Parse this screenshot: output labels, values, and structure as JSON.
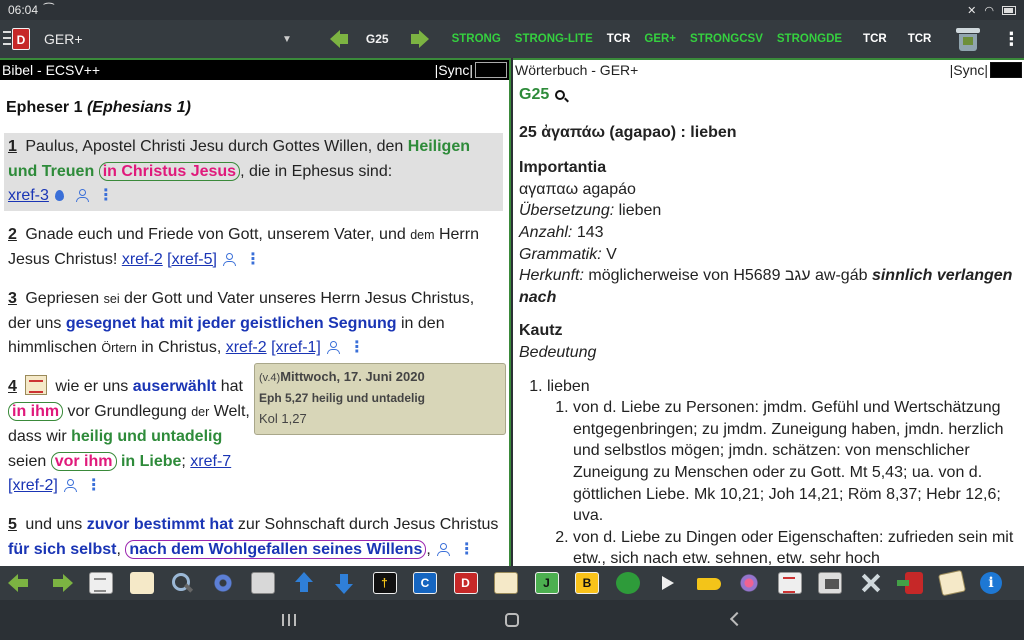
{
  "status": {
    "time": "06:04"
  },
  "toolbar": {
    "module": "GER+",
    "strong_number": "G25",
    "buttons": [
      {
        "label": "STRONG",
        "color": "green"
      },
      {
        "label": "STRONG-LITE",
        "color": "green"
      },
      {
        "label": "TCR",
        "color": "white"
      },
      {
        "label": "GER+",
        "color": "green"
      },
      {
        "label": "STRONGCSV",
        "color": "green"
      },
      {
        "label": "STRONGDE",
        "color": "green"
      },
      {
        "label": "TCR",
        "color": "white"
      },
      {
        "label": "TCR",
        "color": "white"
      }
    ]
  },
  "left_pane": {
    "title": "Bibel - ECSV++",
    "sync": "|Sync|",
    "heading": "Epheser 1",
    "heading_en": "(Ephesians 1)",
    "v1": {
      "num": "1",
      "t1": " Paulus, Apostel Christi Jesu durch Gottes Willen, den ",
      "g1": "Heiligen und Treuen",
      "box1": "in Christus Jesus",
      "t2": ", die in Ephesus sind:",
      "xref1": "xref-3"
    },
    "v2": {
      "num": "2",
      "t1": " Gnade euch und Friede von Gott, unserem Vater, und ",
      "s1": "dem",
      "t2": " Herrn Jesus Christus! ",
      "xref1": "xref-2",
      "xref2": "[xref-5]"
    },
    "v3": {
      "num": "3",
      "t1": " Gepriesen ",
      "s1": "sei",
      "t2": " der Gott und Vater unseres Herrn Jesus Christus, der uns ",
      "b1": "gesegnet hat mit jeder geistlichen Segnung",
      "t3": " in den himmlischen ",
      "s2": "Örtern",
      "t4": " in Christus, ",
      "xref1": "xref-2",
      "xref2": "[xref-1]"
    },
    "v4": {
      "num": "4",
      "t1": " wie er uns ",
      "b1": "auserwählt",
      "t2": " hat ",
      "box1": "in ihm",
      "t3": " vor Grundlegung ",
      "s1": "der",
      "t4": " Welt, dass wir ",
      "g1": "heilig und untadelig",
      "t5": " seien ",
      "box2": "vor ihm",
      "g2": " in Liebe",
      "t6": "; ",
      "xref1": "xref-7",
      "xref2": "[xref-2]"
    },
    "v5": {
      "num": "5",
      "t1": " und uns ",
      "b1": "zuvor bestimmt hat",
      "t2": " zur Sohnschaft durch Jesus Christus ",
      "b2": "für sich selbst",
      "t3": ", ",
      "box1": "nach dem Wohlgefallen seines Willens",
      "t4": ","
    },
    "note": {
      "ref": "(v.4)",
      "date": "Mittwoch, 17. Juni 2020",
      "line2": "Eph 5,27 heilig und untadelig",
      "line3": "Kol 1,27"
    }
  },
  "right_pane": {
    "title": "Wörterbuch - GER+",
    "sync": "|Sync|",
    "key": "G25",
    "entry": "25 ἀγαπάω (agapao) : lieben",
    "importantia": "Importantia",
    "translit": "αγαπαω agapáo",
    "uebersetzung_label": "Übersetzung:",
    "uebersetzung": " lieben",
    "anzahl_label": "Anzahl:",
    "anzahl": " 143",
    "grammatik_label": "Grammatik:",
    "grammatik": " V",
    "herkunft_label": "Herkunft:",
    "herkunft": " möglicherweise von H5689 עגב aw-gáb ",
    "herkunft_bi": "sinnlich verlangen nach",
    "kautz": "Kautz",
    "bedeutung": "Bedeutung",
    "li1": "lieben",
    "sub1": "von d. Liebe zu Personen: jmdm. Gefühl und Wertschätzung entgegenbringen; zu jmdm. Zuneigung haben, jmdn. herzlich und selbstlos mögen; jmdn. schätzen: von menschlicher Zuneigung zu Menschen oder zu Gott. Mt 5,43; ua. von d. göttlichen Liebe. Mk 10,21; Joh 14,21; Röm 8,37; Hebr 12,6; uva.",
    "sub2": "von d. Liebe zu Dingen oder Eigenschaften: zufrieden sein mit etw., sich nach etw. sehnen, etw. sehr hoch"
  },
  "bottombar": {
    "book_letters": {
      "c": "C",
      "d": "D",
      "j": "J",
      "b": "B",
      "info": "i"
    }
  }
}
